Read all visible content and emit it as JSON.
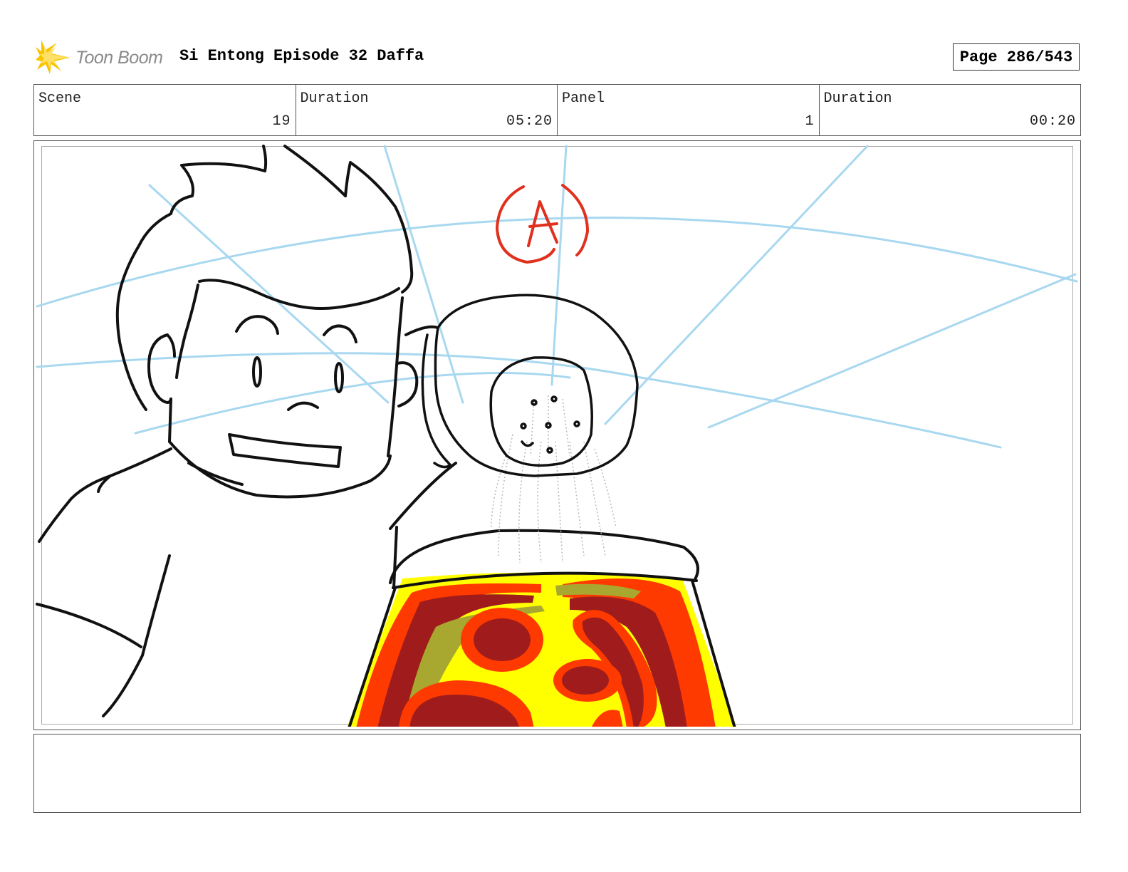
{
  "header": {
    "logo_text": "Toon Boom",
    "title": "Si Entong Episode 32 Daffa",
    "page_label": "Page 286/543"
  },
  "info": {
    "scene_label": "Scene",
    "scene_value": "19",
    "duration_label": "Duration",
    "duration_value": "05:20",
    "panel_label": "Panel",
    "panel_value": "1",
    "panel_duration_label": "Duration",
    "panel_duration_value": "00:20"
  },
  "panel": {
    "marker_text": "A",
    "marker_color": "#e0301e",
    "guide_color": "#a8d8f0",
    "pizza_colors": [
      "#ffff00",
      "#ff3a00",
      "#a01c1c",
      "#a8a830"
    ]
  },
  "notes": {
    "text": ""
  }
}
